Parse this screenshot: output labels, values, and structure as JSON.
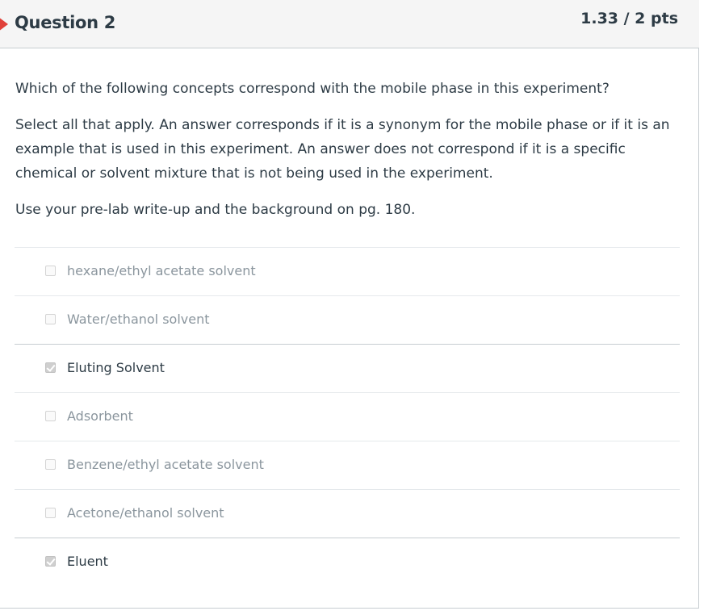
{
  "question": {
    "title": "Question 2",
    "points": "1.33 / 2 pts",
    "prompt": "Which of the following concepts correspond with the mobile phase in this experiment?",
    "instructions": "Select all that apply. An answer corresponds if it is a synonym for the mobile phase or if it is an example that is used in this experiment. An answer does not correspond if it is a specific chemical or solvent mixture that is not being used in the experiment.",
    "hint": "Use your pre-lab write-up and the background on pg. 180.",
    "flag_color": "#e0413a"
  },
  "answers": [
    {
      "label": "hexane/ethyl acetate solvent",
      "checked": false
    },
    {
      "label": "Water/ethanol solvent",
      "checked": false
    },
    {
      "label": "Eluting Solvent",
      "checked": true
    },
    {
      "label": "Adsorbent",
      "checked": false
    },
    {
      "label": "Benzene/ethyl acetate solvent",
      "checked": false
    },
    {
      "label": "Acetone/ethanol solvent",
      "checked": false
    },
    {
      "label": "Eluent",
      "checked": true
    }
  ]
}
